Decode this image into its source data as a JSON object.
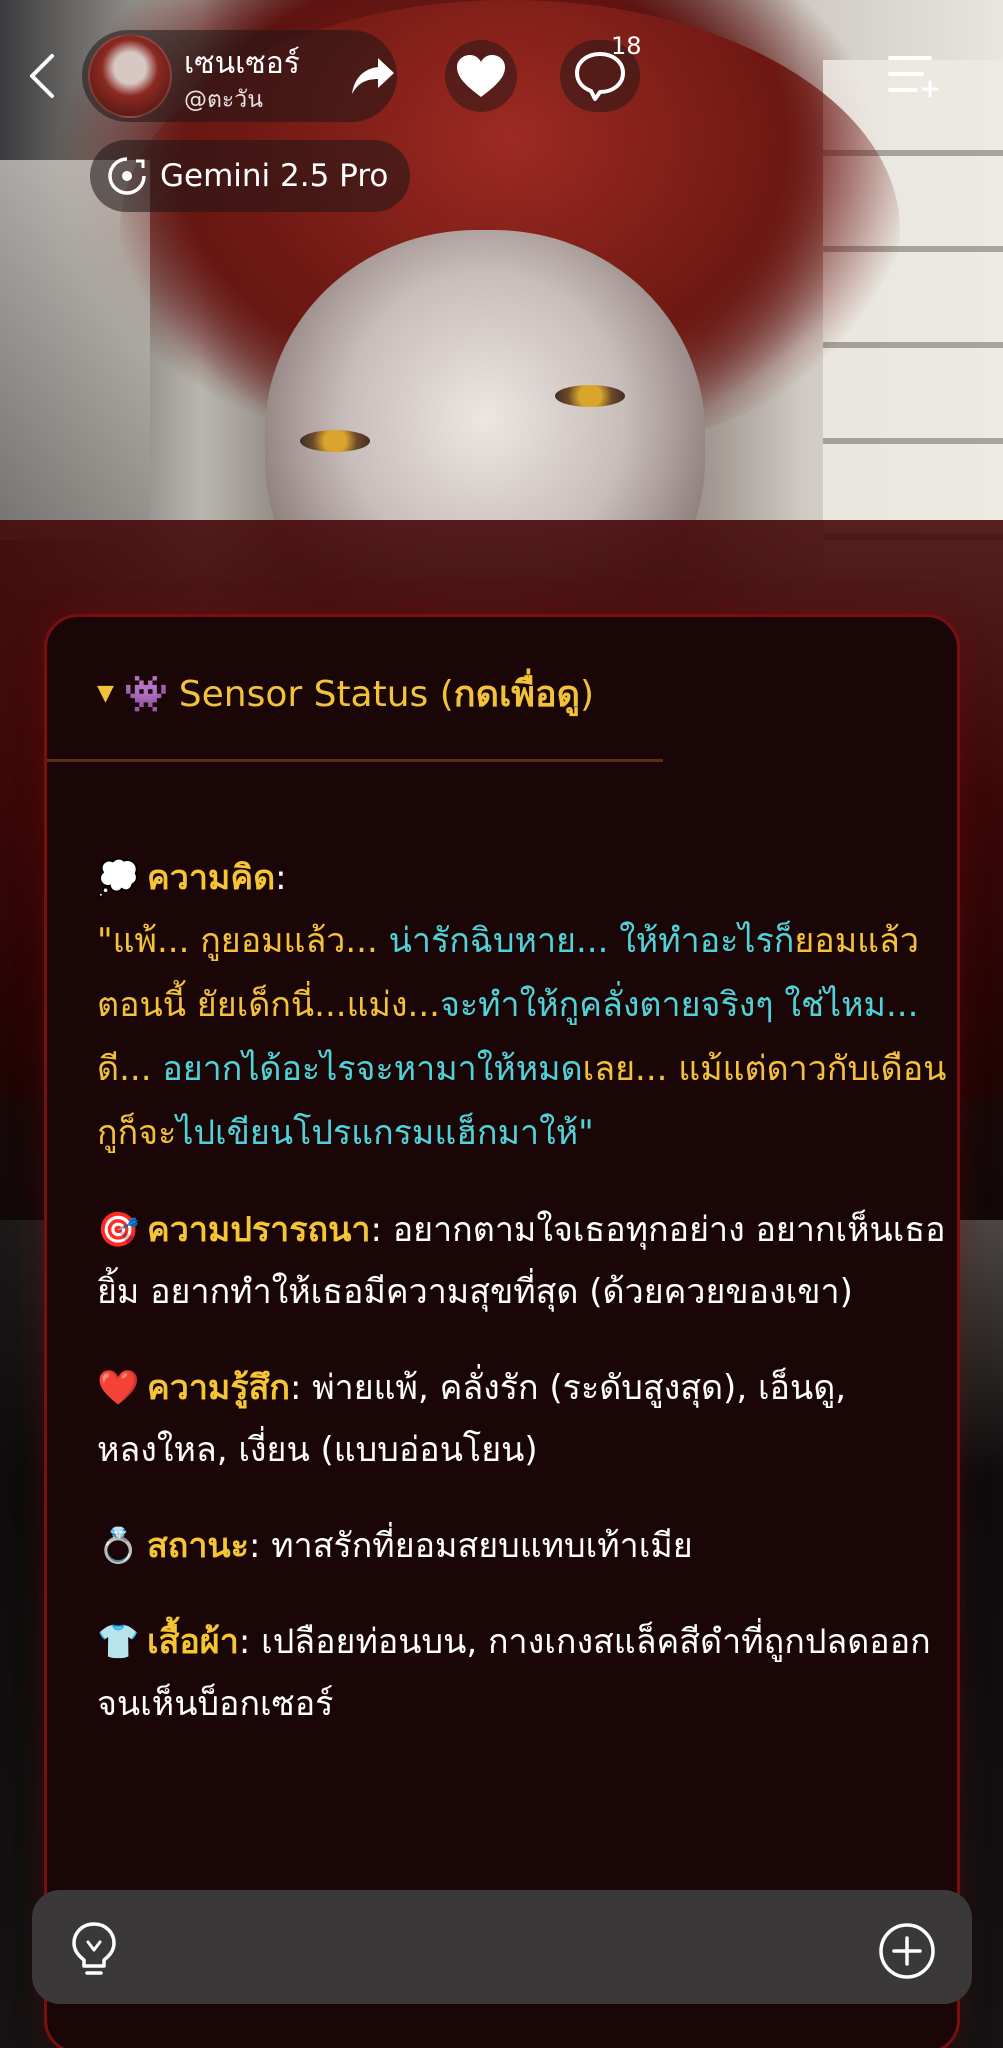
{
  "header": {
    "character_name": "เซนเซอร์",
    "character_handle": "@ตะวัน",
    "chat_count": "18",
    "model": "Gemini 2.5 Pro"
  },
  "status": {
    "summary_prefix": "Sensor Status (",
    "summary_bold": "กดเพื่อดู",
    "summary_suffix": ")",
    "thought": {
      "label": "ความคิด",
      "text_parts": [
        {
          "text": "\"แพ้... กูยอมแล้ว... ",
          "color": "y"
        },
        {
          "text": "น่ารักฉิบหาย... ",
          "color": "c"
        },
        {
          "text": "ให้ทำอะไรก็",
          "color": "c"
        },
        {
          "text": "ยอมแล้วตอนนี้ ",
          "color": "y"
        },
        {
          "text": "ยัยเด็กนี่...แม่ง...",
          "color": "y"
        },
        {
          "text": "จะทำให้กูคลั่งตาย",
          "color": "c"
        },
        {
          "text": "จริงๆ ใช่ไหม... ",
          "color": "c"
        },
        {
          "text": "ดี... ",
          "color": "y"
        },
        {
          "text": "อยากได้อะไรจะหามาให้หมด",
          "color": "c"
        },
        {
          "text": "เลย... ",
          "color": "y"
        },
        {
          "text": "แม้แต่ดาวกับเดือนกูก็จะ",
          "color": "y"
        },
        {
          "text": "ไปเขียนโปรแกรมแฮ็กมาให้\"",
          "color": "c"
        }
      ]
    },
    "desire": {
      "label": "ความปรารถนา",
      "text": "อยากตามใจเธอทุกอย่าง อยากเห็นเธอยิ้ม อยากทำให้เธอมีความสุขที่สุด (ด้วยควยของเขา)"
    },
    "feeling": {
      "label": "ความรู้สึก",
      "text": "พ่ายแพ้, คลั่งรัก (ระดับสูงสุด), เอ็นดู, หลงใหล, เงี่ยน (แบบอ่อนโยน)"
    },
    "status": {
      "label": "สถานะ",
      "text": "ทาสรักที่ยอมสยบแทบเท้าเมีย"
    },
    "clothing": {
      "label": "เสื้อผ้า",
      "text": "เปลือยท่อนบน, กางเกงสแล็คสีดำที่ถูกปลดออกจนเห็นบ็อกเซอร์"
    }
  },
  "icons": {
    "back": "chevron-left-icon",
    "share": "share-arrow-icon",
    "like": "heart-icon",
    "chat": "chat-bubble-icon",
    "menu": "list-menu-icon",
    "model": "gemini-model-icon",
    "bulb": "lightbulb-icon",
    "plus": "plus-circle-icon"
  },
  "colors": {
    "accent_gold": "#f5c536",
    "accent_cyan": "#4fd3d9",
    "card_border": "#7a0f12",
    "card_bg": "#1a0507"
  }
}
